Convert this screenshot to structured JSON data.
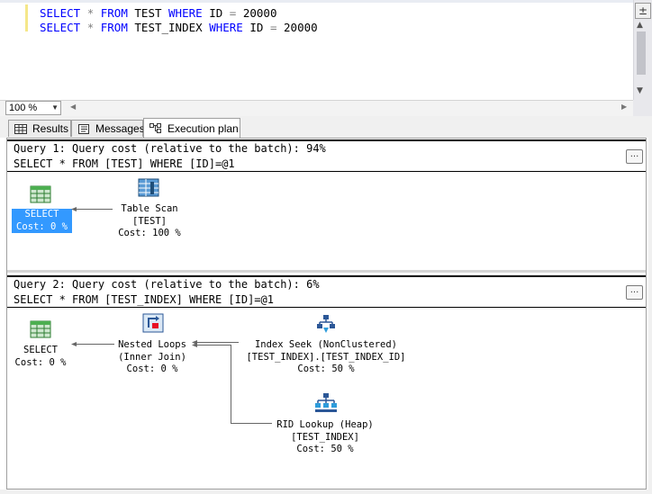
{
  "editor": {
    "line1": {
      "kw1": "SELECT",
      "star": "*",
      "kw2": "FROM",
      "table": "TEST",
      "kw3": "WHERE",
      "col": "ID",
      "eq": "=",
      "val": "20000"
    },
    "line2": {
      "kw1": "SELECT",
      "star": "*",
      "kw2": "FROM",
      "table": "TEST_INDEX",
      "kw3": "WHERE",
      "col": "ID",
      "eq": "=",
      "val": "20000"
    }
  },
  "zoom": {
    "value": "100 %"
  },
  "tabs": [
    {
      "label": "Results",
      "icon": "grid-icon"
    },
    {
      "label": "Messages",
      "icon": "messages-icon"
    },
    {
      "label": "Execution plan",
      "icon": "execution-plan-icon"
    }
  ],
  "plans": [
    {
      "header": "Query 1: Query cost (relative to the batch): 94%",
      "sql": "SELECT * FROM [TEST] WHERE [ID]=@1",
      "nodes": [
        {
          "line1": "SELECT",
          "line2": "Cost: 0 %",
          "icon": "select-result-icon"
        },
        {
          "line1": "Table Scan",
          "line2": "[TEST]",
          "line3": "Cost: 100 %",
          "icon": "table-scan-icon"
        }
      ]
    },
    {
      "header": "Query 2: Query cost (relative to the batch): 6%",
      "sql": "SELECT * FROM [TEST_INDEX] WHERE [ID]=@1",
      "nodes": [
        {
          "line1": "SELECT",
          "line2": "Cost: 0 %",
          "icon": "select-result-icon"
        },
        {
          "line1": "Nested Loops",
          "line2": "(Inner Join)",
          "line3": "Cost: 0 %",
          "icon": "nested-loops-icon"
        },
        {
          "line1": "Index Seek (NonClustered)",
          "line2": "[TEST_INDEX].[TEST_INDEX_ID]",
          "line3": "Cost: 50 %",
          "icon": "index-seek-icon"
        },
        {
          "line1": "RID Lookup (Heap)",
          "line2": "[TEST_INDEX]",
          "line3": "Cost: 50 %",
          "icon": "rid-lookup-icon"
        }
      ]
    }
  ],
  "colors": {
    "keyword": "#0000ff",
    "operator": "#808080",
    "selection": "#3399ff"
  }
}
